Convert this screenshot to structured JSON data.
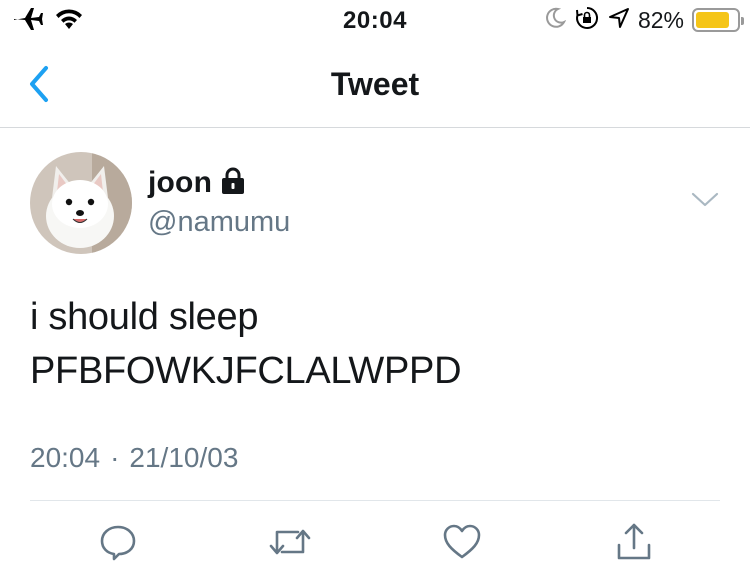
{
  "status_bar": {
    "time": "20:04",
    "battery_percent": "82%",
    "battery_level": 0.82,
    "icons": [
      "airplane-icon",
      "wifi-icon",
      "moon-icon",
      "rotation-lock-icon",
      "location-icon",
      "battery-icon"
    ]
  },
  "nav": {
    "title": "Tweet",
    "back_icon": "chevron-left-icon"
  },
  "tweet": {
    "display_name": "joon",
    "handle": "@namumu",
    "protected_icon": "lock-icon",
    "text_lines": [
      "i should sleep",
      "PFBFOWKJFCLALWPPD"
    ],
    "time": "20:04",
    "separator": "·",
    "date": "21/10/03",
    "menu_icon": "chevron-down-icon"
  },
  "actions": {
    "reply_icon": "reply-icon",
    "retweet_icon": "retweet-icon",
    "like_icon": "heart-icon",
    "share_icon": "share-icon"
  },
  "colors": {
    "accent": "#1da1f2",
    "secondary_text": "#657786",
    "battery_fill": "#f5c518"
  }
}
